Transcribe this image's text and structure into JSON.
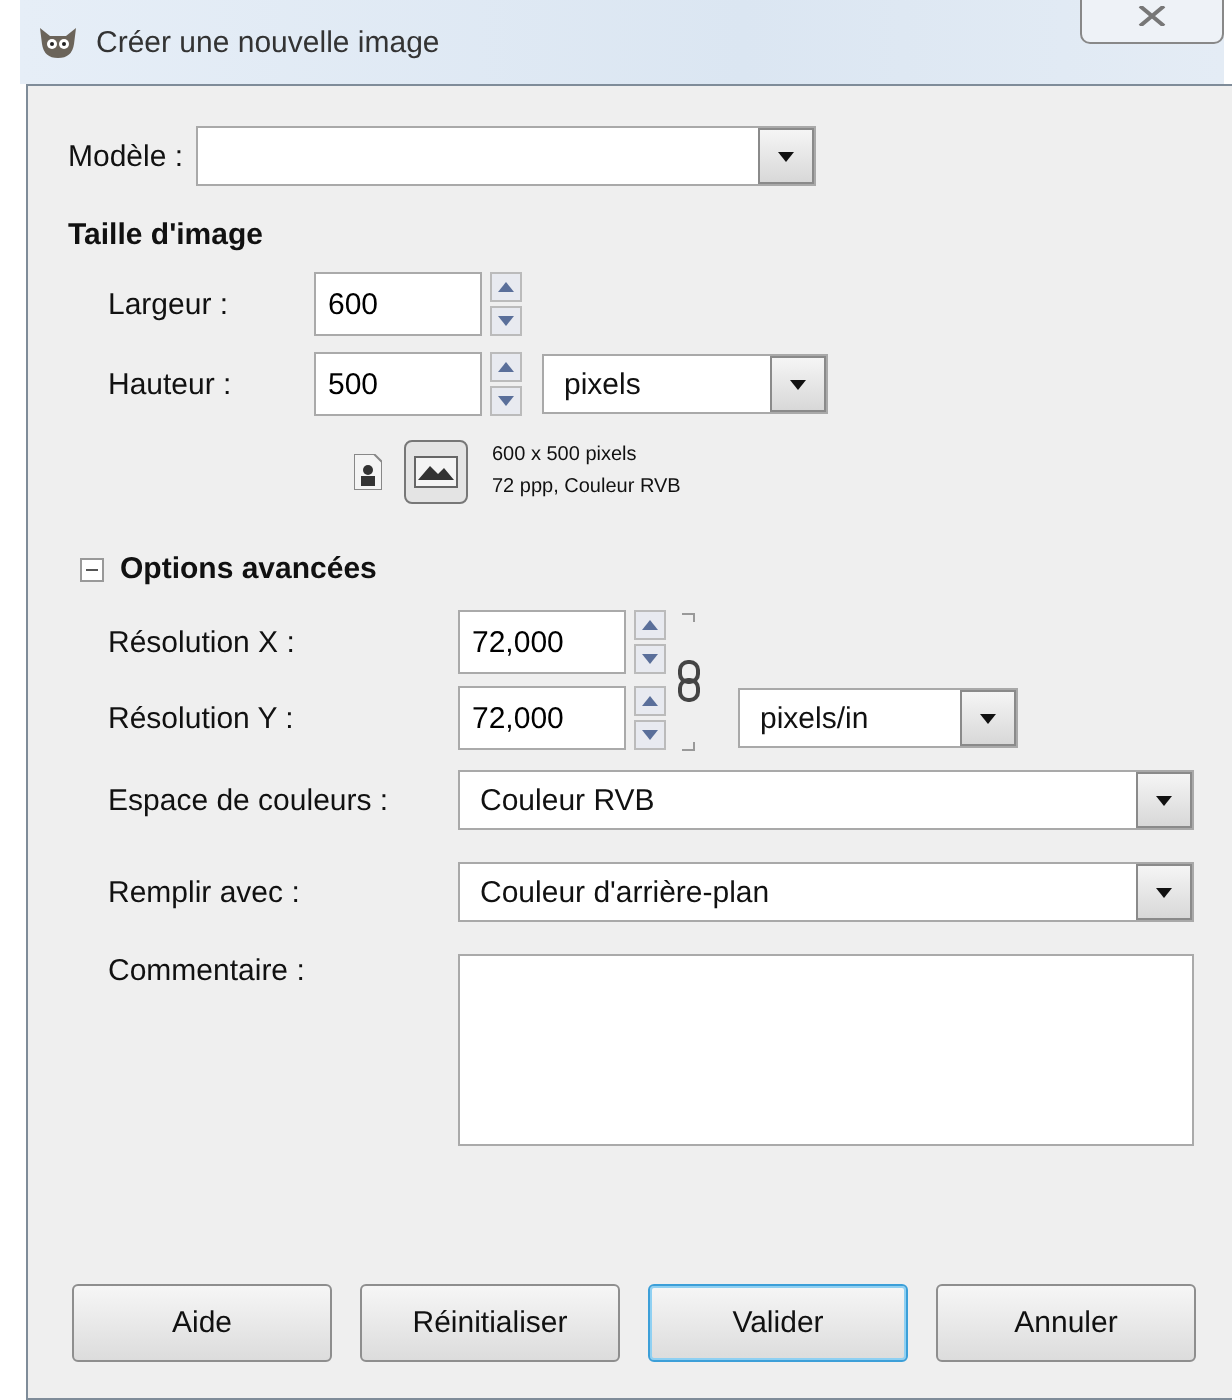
{
  "window": {
    "title": "Créer une nouvelle image"
  },
  "template": {
    "label": "Modèle :"
  },
  "image_size": {
    "heading": "Taille d'image",
    "width": {
      "label": "Largeur :",
      "value": "600"
    },
    "height": {
      "label": "Hauteur :",
      "value": "500"
    },
    "unit": "pixels",
    "orientations": [
      {
        "kind": "portrait",
        "selected": false
      },
      {
        "kind": "landscape",
        "selected": true
      }
    ],
    "info": [
      "600 x 500 pixels",
      "72 ppp, Couleur RVB"
    ]
  },
  "advanced": {
    "heading": "Options avancées",
    "expanded": true,
    "res_x": {
      "label": "Résolution X :",
      "value": "72,000"
    },
    "res_y": {
      "label": "Résolution Y :",
      "value": "72,000"
    },
    "res_unit": "pixels/in",
    "colorspace": {
      "label": "Espace de couleurs :",
      "value": "Couleur RVB"
    },
    "fill": {
      "label": "Remplir avec :",
      "value": "Couleur d'arrière-plan"
    },
    "comment": {
      "label": "Commentaire :"
    }
  },
  "buttons": [
    {
      "label": "Aide",
      "selected": false
    },
    {
      "label": "Réinitialiser",
      "selected": false
    },
    {
      "label": "Valider",
      "selected": true
    },
    {
      "label": "Annuler",
      "selected": false
    }
  ]
}
